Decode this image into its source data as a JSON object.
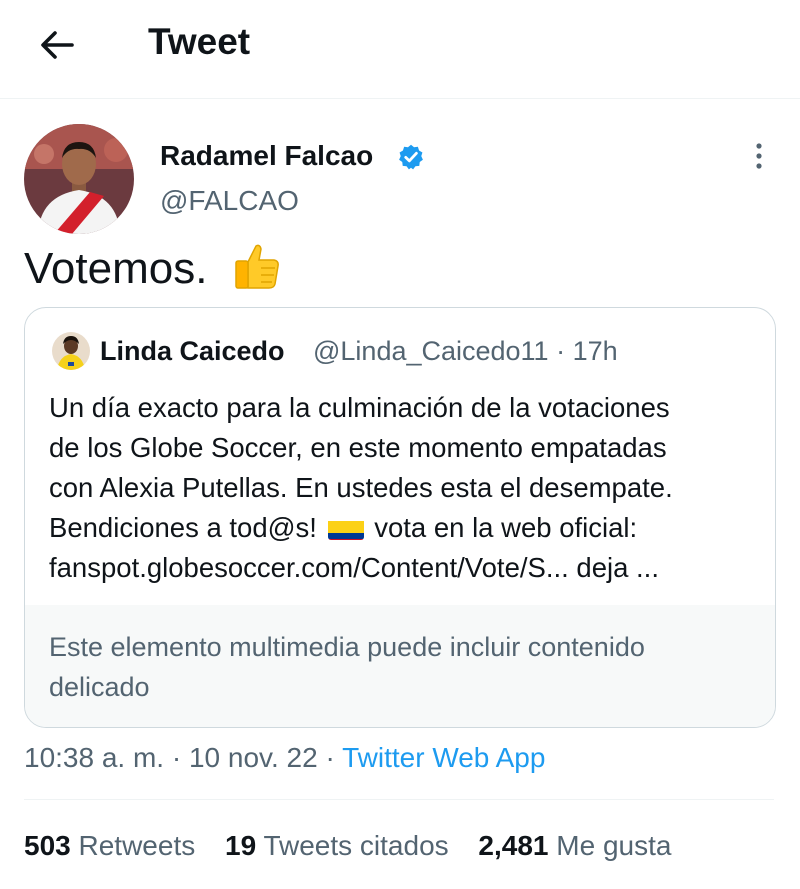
{
  "header": {
    "title": "Tweet",
    "back_icon": "arrow-left-icon"
  },
  "author": {
    "name": "Radamel Falcao",
    "handle": "@FALCAO",
    "verified": true,
    "verified_color": "#1d9bf0"
  },
  "tweet": {
    "text": "Votemos.",
    "emoji": "thumbs-up-icon"
  },
  "quote": {
    "name": "Linda Caicedo",
    "handle": "@Linda_Caicedo11",
    "separator": "·",
    "time": "17h",
    "lines": {
      "l1": "Un día exacto para la culminación de la votaciones",
      "l2": "de los Globe Soccer, en este momento empatadas",
      "l3": "con Alexia Putellas. En ustedes esta el desempate.",
      "l4a": "Bendiciones a tod@s!",
      "l4b": "vota en la web oficial:",
      "l5": "fanspot.globesoccer.com/Content/Vote/S... deja ..."
    },
    "flag_icon": "colombia-flag-icon",
    "media_notice": "Este elemento multimedia puede incluir contenido delicado"
  },
  "meta": {
    "time": "10:38 a. m.",
    "separator": "·",
    "date": "10 nov. 22",
    "source": "Twitter Web App"
  },
  "stats": [
    {
      "count": "503",
      "label": "Retweets"
    },
    {
      "count": "19",
      "label": "Tweets citados"
    },
    {
      "count": "2,481",
      "label": "Me gusta"
    }
  ],
  "colors": {
    "accent": "#1d9bf0",
    "text": "#0f1419",
    "secondary": "#536471"
  }
}
